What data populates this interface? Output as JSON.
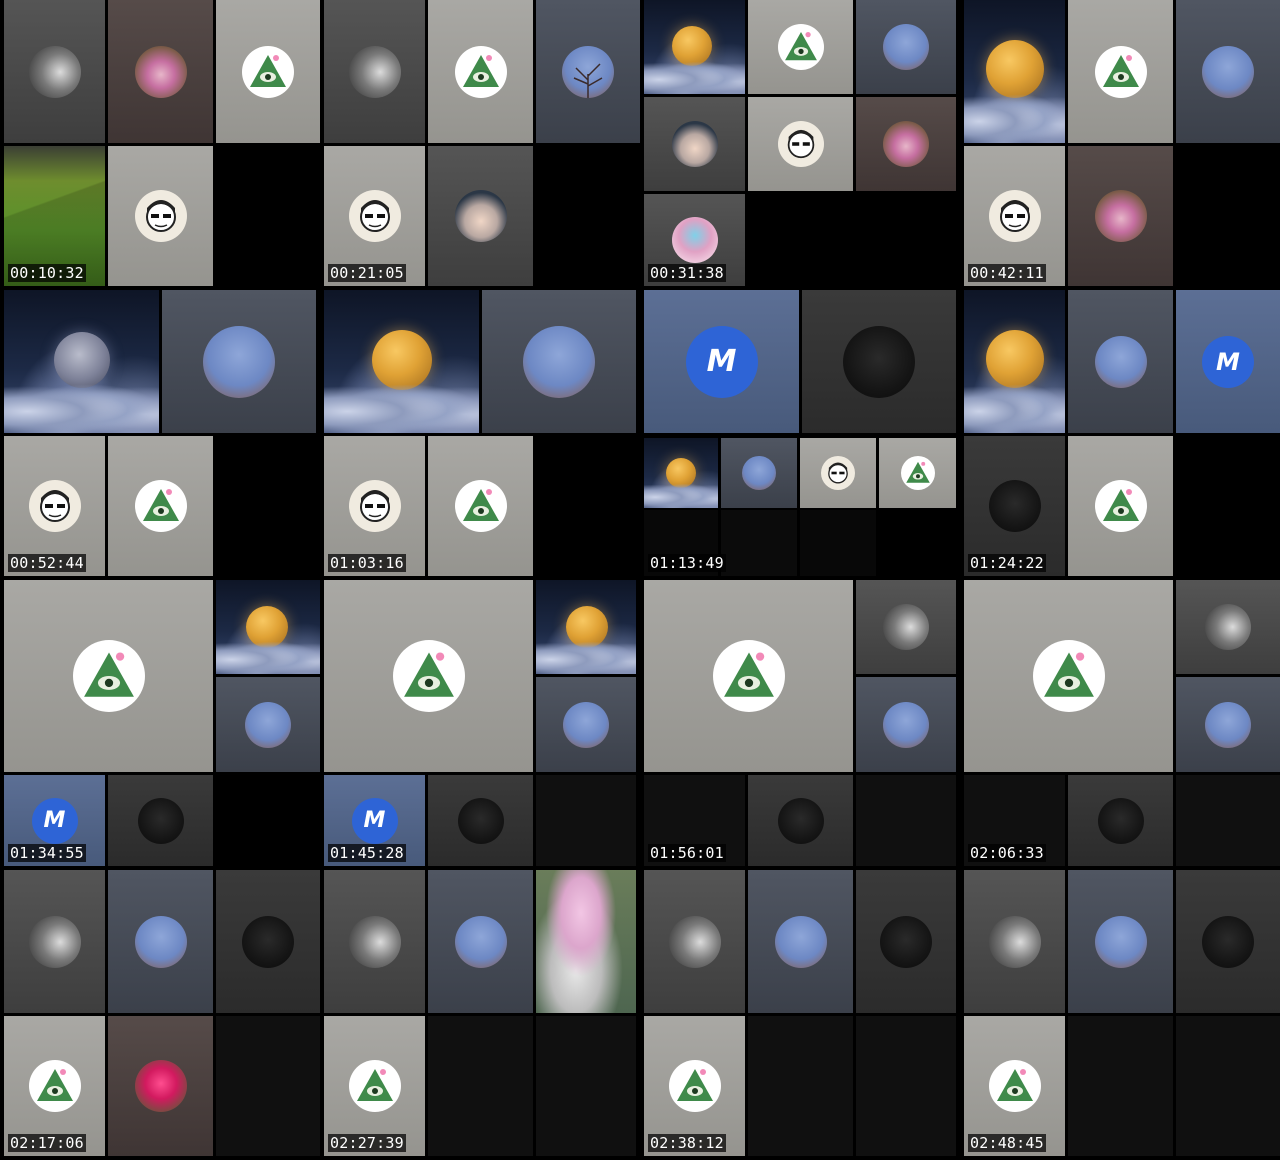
{
  "contact_sheet": {
    "frames": [
      {
        "timestamp": "00:10:32"
      },
      {
        "timestamp": "00:21:05"
      },
      {
        "timestamp": "00:31:38"
      },
      {
        "timestamp": "00:42:11"
      },
      {
        "timestamp": "00:52:44"
      },
      {
        "timestamp": "01:03:16"
      },
      {
        "timestamp": "01:13:49"
      },
      {
        "timestamp": "01:24:22"
      },
      {
        "timestamp": "01:34:55"
      },
      {
        "timestamp": "01:45:28"
      },
      {
        "timestamp": "01:56:01"
      },
      {
        "timestamp": "02:06:33"
      },
      {
        "timestamp": "02:17:06"
      },
      {
        "timestamp": "02:27:39"
      },
      {
        "timestamp": "02:38:12"
      },
      {
        "timestamp": "02:48:45"
      }
    ]
  },
  "icons": {
    "participant_avatar": "avatar-icon",
    "illuminati_eye": "eye-pyramid-icon",
    "brand_logo": "m-logo-icon",
    "moon": "moon-icon"
  },
  "logo_text": "M",
  "colors": {
    "background": "#000000",
    "logo_blue": "#2e64d6",
    "timestamp_text": "#ffffff"
  }
}
